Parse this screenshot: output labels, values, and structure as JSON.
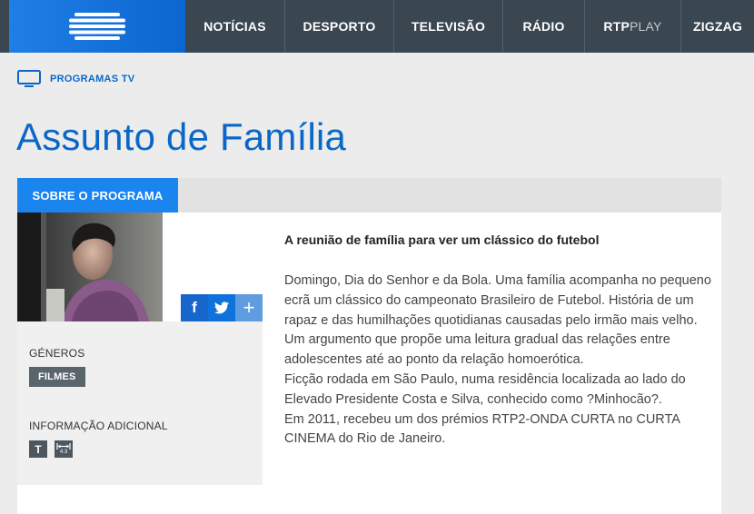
{
  "nav": {
    "items": [
      {
        "label": "NOTÍCIAS"
      },
      {
        "label": "DESPORTO"
      },
      {
        "label": "TELEVISÃO"
      },
      {
        "label": "RÁDIO"
      },
      {
        "label_bold": "RTP",
        "label_light": "PLAY"
      },
      {
        "label": "ZIGZAG"
      }
    ]
  },
  "breadcrumb": {
    "label": "PROGRAMAS TV",
    "icon": "tv-monitor-icon"
  },
  "page": {
    "title": "Assunto de Família"
  },
  "tabs": [
    {
      "label": "SOBRE O PROGRAMA"
    }
  ],
  "share": {
    "facebook": "f",
    "more": "+"
  },
  "sidebar": {
    "genres_label": "GÉNEROS",
    "genre": "FILMES",
    "info_label": "INFORMAÇÃO ADICIONAL",
    "info_icons": [
      {
        "name": "teletext-icon",
        "text": "T"
      },
      {
        "name": "aspect-ratio-icon",
        "text": "4:3"
      }
    ]
  },
  "article": {
    "headline": "A reunião de família para ver um clássico do futebol",
    "paragraphs": [
      "Domingo, Dia do Senhor e da Bola. Uma família acompanha no pequeno ecrã um clássico do campeonato Brasileiro de Futebol. História de um rapaz e das humilhações quotidianas causadas pelo irmão mais velho. Um argumento que propõe uma leitura gradual das relações entre adolescentes até ao ponto da relação homoerótica.",
      "Ficção rodada em São Paulo, numa residência localizada ao lado do Elevado Presidente Costa e Silva, conhecido como ?Minhocão?.",
      "Em 2011, recebeu um dos prémios RTP2-ONDA CURTA no CURTA CINEMA do Rio de Janeiro."
    ]
  },
  "colors": {
    "nav_bg": "#3a4650",
    "brand_blue": "#0a67c8",
    "tab_blue": "#1a84ef"
  }
}
